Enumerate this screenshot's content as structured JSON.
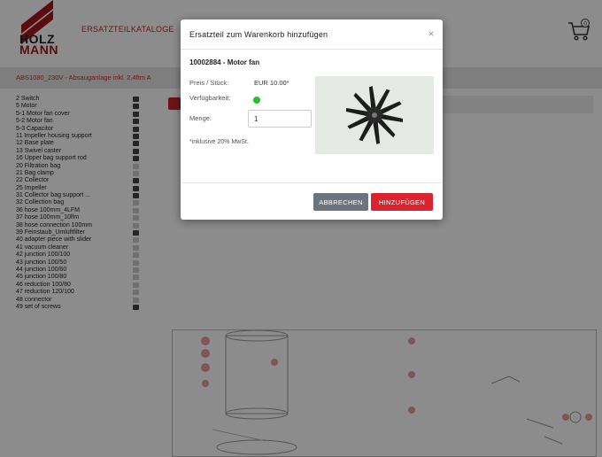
{
  "header": {
    "logo": {
      "line1": "HOLZ",
      "line2": "MANN"
    },
    "nav_link": "ERSATZTEILKATALOGE",
    "cart_badge": "0",
    "cart_icon": "shopping-cart-icon"
  },
  "breadcrumb": "ABS1080_230V - Absauganlage inkl. 2,4ftm A",
  "sidebar": {
    "items": [
      {
        "label": "2 Switch",
        "icon": "dark"
      },
      {
        "label": "5 Motor",
        "icon": "dark"
      },
      {
        "label": "5-1 Motor fan cover",
        "icon": "dark"
      },
      {
        "label": "5-2 Motor fan",
        "icon": "dark"
      },
      {
        "label": "5-3 Capacitor",
        "icon": "dark"
      },
      {
        "label": "11 Impeller housing support",
        "icon": "dark"
      },
      {
        "label": "12 Base plate",
        "icon": "dark"
      },
      {
        "label": "13 Swivel caster",
        "icon": "dark"
      },
      {
        "label": "16 Upper bag support rod",
        "icon": "dark"
      },
      {
        "label": "20 Filtration bag",
        "icon": "light"
      },
      {
        "label": "21 Bag clamp",
        "icon": "light"
      },
      {
        "label": "22 Collector",
        "icon": "dark"
      },
      {
        "label": "25 Impeller",
        "icon": "dark"
      },
      {
        "label": "31 Collector bag support ...",
        "icon": "dark"
      },
      {
        "label": "32 Collection bag",
        "icon": "light"
      },
      {
        "label": "36 hose 100mm_4LFM",
        "icon": "light"
      },
      {
        "label": "37 hose 100mm_10lfm",
        "icon": "light"
      },
      {
        "label": "38 hose connection 100mm",
        "icon": "light"
      },
      {
        "label": "39 Feinstaub_Umluftfilter",
        "icon": "dark"
      },
      {
        "label": "40 adapter piece with slider",
        "icon": "light"
      },
      {
        "label": "41 vacuum cleaner",
        "icon": "light"
      },
      {
        "label": "42 junction 100/100",
        "icon": "light"
      },
      {
        "label": "43 junction 100/50",
        "icon": "light"
      },
      {
        "label": "44 junction 100/60",
        "icon": "light"
      },
      {
        "label": "45 junction 100/80",
        "icon": "light"
      },
      {
        "label": "46 reduction 100/80",
        "icon": "light"
      },
      {
        "label": "47 reduction 120/100",
        "icon": "light"
      },
      {
        "label": "48 connector",
        "icon": "light"
      },
      {
        "label": "49 set of screws",
        "icon": "dark"
      }
    ]
  },
  "modal": {
    "title": "Ersatzteil zum Warenkorb hinzufügen",
    "close": "×",
    "part_title": "10002884 - Motor fan",
    "price_label": "Preis / Stück:",
    "price_value": "EUR 10.00*",
    "availability_label": "Verfügbarkeit:",
    "availability_color": "#22c32a",
    "quantity_label": "Menge:",
    "quantity_value": "1",
    "note": "*inklusive 20% MwSt.",
    "cancel_label": "ABBRECHEN",
    "add_label": "HINZUFÜGEN"
  },
  "colors": {
    "brand_red": "#c8252c",
    "button_red": "#d9232e",
    "button_gray": "#6c757d"
  }
}
